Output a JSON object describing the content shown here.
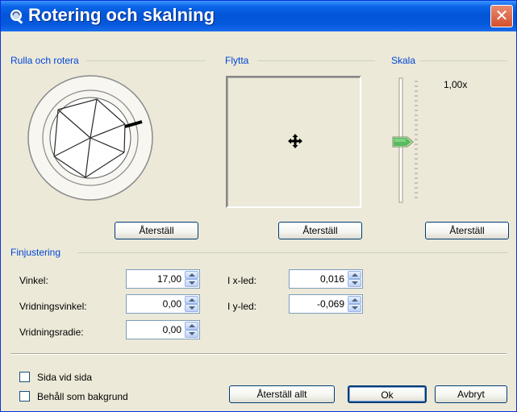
{
  "window": {
    "title": "Rotering och skalning",
    "close_glyph": "✕"
  },
  "groups": {
    "roll_label": "Rulla och rotera",
    "move_label": "Flytta",
    "scale_label": "Skala",
    "fine_label": "Finjustering"
  },
  "scale": {
    "value_text": "1,00x",
    "slider_fraction": 0.5
  },
  "buttons": {
    "reset_roll": "Återställ",
    "reset_move": "Återställ",
    "reset_scale": "Återställ",
    "reset_all": "Återställ allt",
    "ok": "Ok",
    "cancel": "Avbryt"
  },
  "fields": {
    "vinkel": {
      "label": "Vinkel:",
      "value": "17,00"
    },
    "vridningsvinkel": {
      "label": "Vridningsvinkel:",
      "value": "0,00"
    },
    "vridningsradie": {
      "label": "Vridningsradie:",
      "value": "0,00"
    },
    "x_led": {
      "label": "I x-led:",
      "value": "0,016"
    },
    "y_led": {
      "label": "I y-led:",
      "value": "-0,069"
    }
  },
  "checkboxes": {
    "side_by_side": {
      "label": "Sida vid sida",
      "checked": false
    },
    "keep_background": {
      "label": "Behåll som bakgrund",
      "checked": false
    }
  },
  "icons": {
    "title_icon": "rotate-tool-icon",
    "move_icon": "move-cross-icon",
    "close_icon": "close-icon"
  },
  "colors": {
    "title_blue": "#0455d8",
    "group_label": "#0046d5",
    "dialog_bg": "#ece9d8"
  }
}
